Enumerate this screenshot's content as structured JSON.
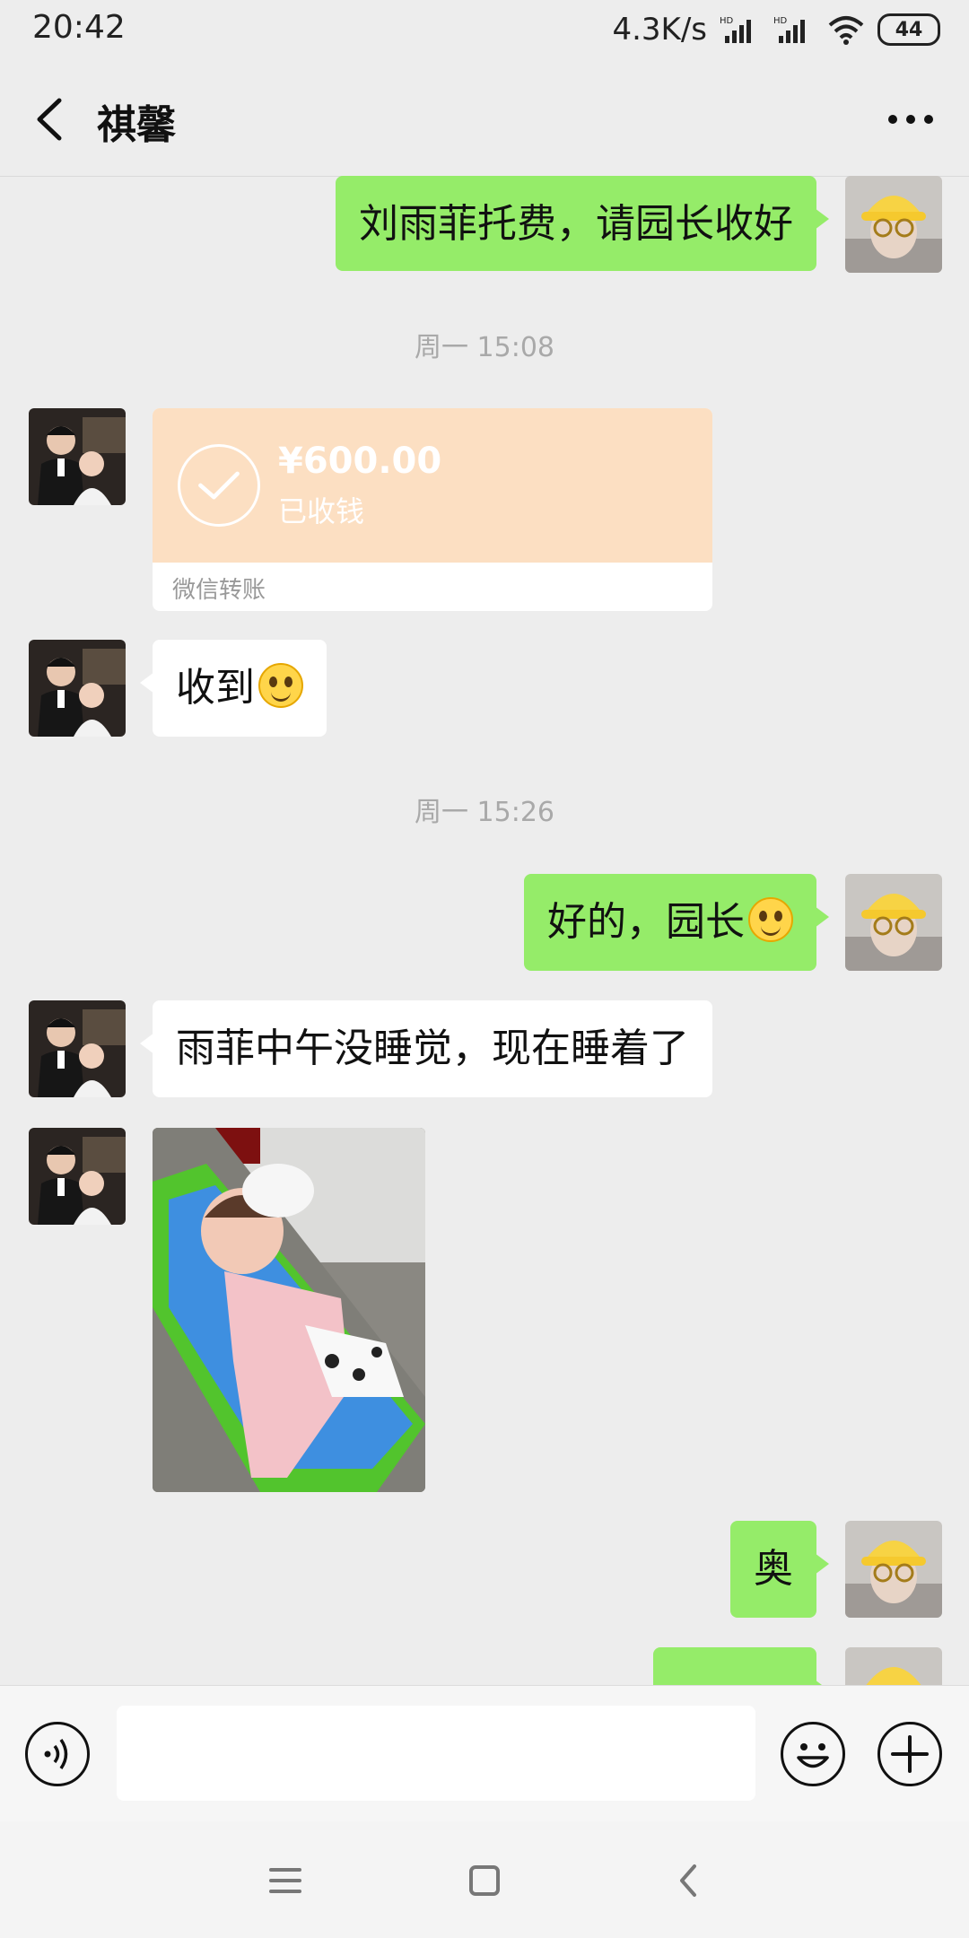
{
  "status_bar": {
    "time": "20:42",
    "speed": "4.3K/s",
    "battery": "44",
    "icons": [
      "hd-signal-icon",
      "hd-signal-icon",
      "wifi-icon",
      "battery-icon"
    ]
  },
  "header": {
    "title": "祺馨",
    "back_icon": "chevron-left-icon",
    "more_icon": "more-dots-icon"
  },
  "messages": [
    {
      "from": "me",
      "type": "text",
      "text": "刘雨菲托费，请园长收好"
    },
    {
      "type": "time",
      "text": "周一 15:08"
    },
    {
      "from": "them",
      "type": "transfer",
      "amount": "¥600.00",
      "status": "已收钱",
      "label": "微信转账"
    },
    {
      "from": "them",
      "type": "text",
      "text": "收到",
      "emoji": "smile-emoji"
    },
    {
      "type": "time",
      "text": "周一 15:26"
    },
    {
      "from": "me",
      "type": "text",
      "text": "好的，园长",
      "emoji": "smile-emoji"
    },
    {
      "from": "them",
      "type": "text",
      "text": "雨菲中午没睡觉，现在睡着了"
    },
    {
      "from": "them",
      "type": "image"
    },
    {
      "from": "me",
      "type": "text",
      "text": "奥"
    }
  ],
  "input_bar": {
    "voice_icon": "voice-icon",
    "emoji_icon": "emoji-face-icon",
    "plus_icon": "plus-icon",
    "input_value": ""
  },
  "nav_bar": {
    "icons": [
      "menu-icon",
      "home-square-icon",
      "back-triangle-icon"
    ]
  },
  "colors": {
    "chat_bg": "#ededed",
    "my_bubble": "#95ec69",
    "their_bubble": "#ffffff",
    "transfer_bg": "#fcdfc2"
  }
}
